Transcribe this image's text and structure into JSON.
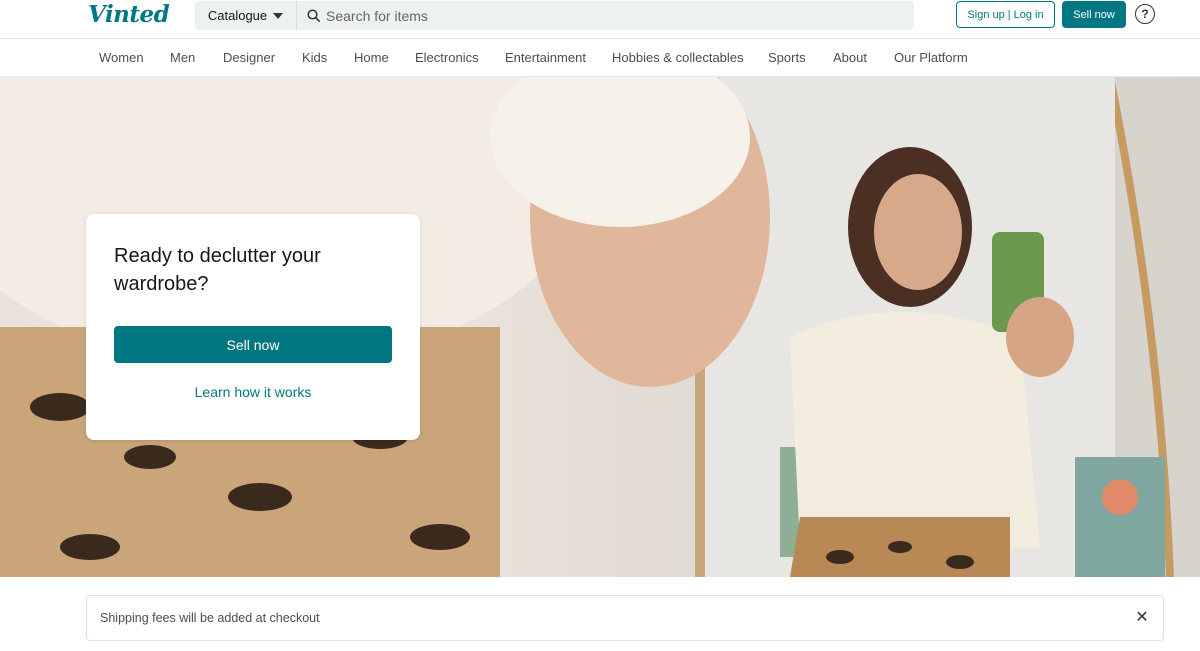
{
  "header": {
    "logo": "Vinted",
    "catalogue_label": "Catalogue",
    "search_placeholder": "Search for items",
    "signup_label": "Sign up",
    "login_label": "Log in",
    "separator": "|",
    "sell_label": "Sell now",
    "help_glyph": "?"
  },
  "nav": {
    "items": [
      "Women",
      "Men",
      "Designer",
      "Kids",
      "Home",
      "Electronics",
      "Entertainment",
      "Hobbies & collectables",
      "Sports",
      "About",
      "Our Platform"
    ]
  },
  "hero": {
    "title": "Ready to declutter your wardrobe?",
    "sell_button": "Sell now",
    "learn_link": "Learn how it works"
  },
  "notice": {
    "text": "Shipping fees will be added at checkout",
    "close_glyph": "✕"
  },
  "colors": {
    "brand": "#007782"
  },
  "icons": {
    "search": "search-icon",
    "help": "help-icon",
    "close": "close-icon",
    "caret": "chevron-down-icon"
  }
}
